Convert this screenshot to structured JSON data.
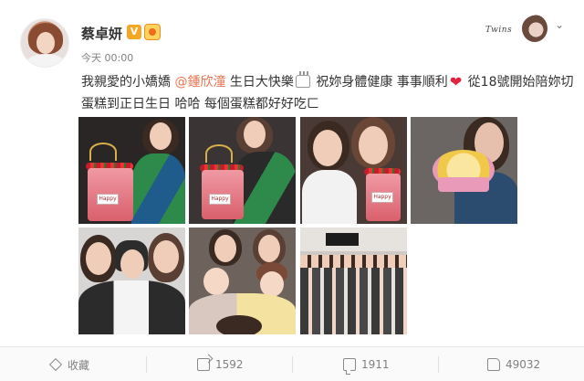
{
  "post": {
    "username": "蔡卓妍",
    "vip_mark": "V",
    "time": "今天 00:00",
    "signature_text": "Twins",
    "text_part1": "我親愛的小嬌嬌 ",
    "mention": "@鍾欣潼",
    "text_part2": " 生日大快樂",
    "text_part3": " 祝妳身體健康 事事順利",
    "text_part4": " 從18號開始陪妳切蛋糕到正日生日 哈哈 每個蛋糕都好好吃ㄈ",
    "plaque_text": "Happy"
  },
  "actions": {
    "favorite_label": "收藏",
    "share_count": "1592",
    "comment_count": "1911",
    "like_count": "49032"
  },
  "icons": [
    "chevron-down-icon",
    "cake-emoji-icon",
    "heart-emoji-icon",
    "star-icon",
    "share-icon",
    "comment-icon",
    "thumbs-up-icon"
  ],
  "colors": {
    "mention": "#eb7350",
    "text": "#333333",
    "muted": "#808080"
  }
}
